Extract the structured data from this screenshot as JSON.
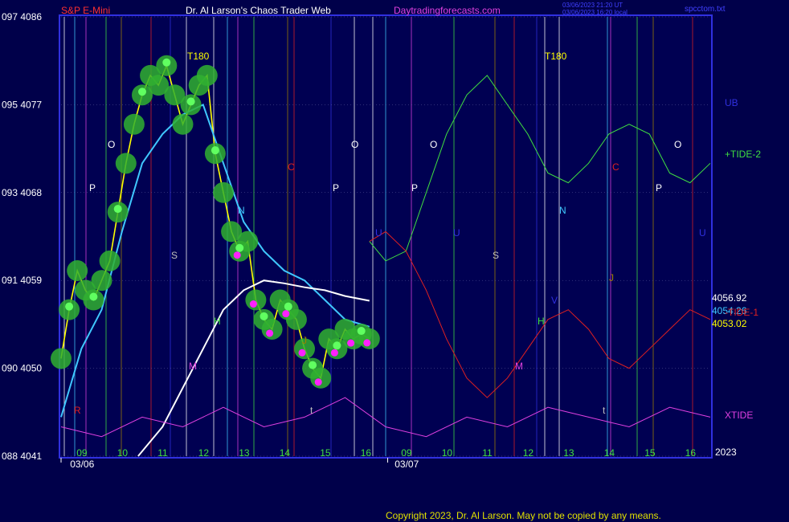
{
  "chart_data": {
    "type": "line",
    "title_left": "S&P E-Mini",
    "title_center": "Dr. Al Larson's Chaos Trader Web",
    "title_site": "Daytradingforecasts.com",
    "timestamp_1": "03/06/2023 21:20 UT",
    "timestamp_2": "03/06/2023 16:20 local",
    "file_label": "spcctom.txt",
    "copyright": "Copyright 2023, Dr. Al Larson. May not be copied by any means.",
    "year_label": "2023",
    "y_axis": {
      "range": [
        4041,
        4086
      ],
      "ticks": [
        {
          "label": "097 4086",
          "value": 4086
        },
        {
          "label": "095 4077",
          "value": 4077
        },
        {
          "label": "093 4068",
          "value": 4068
        },
        {
          "label": "091 4059",
          "value": 4059
        },
        {
          "label": "090 4050",
          "value": 4050
        },
        {
          "label": "088 4041",
          "value": 4041
        }
      ]
    },
    "x_axis": {
      "hour_labels": [
        "09",
        "10",
        "11",
        "12",
        "13",
        "14",
        "15",
        "16",
        "09",
        "10",
        "11",
        "12",
        "13",
        "14",
        "15",
        "16"
      ],
      "date_labels": [
        "03/06",
        "03/07"
      ]
    },
    "price_labels": [
      {
        "text": "4056.92",
        "color": "#ffffff"
      },
      {
        "text": "4054.26",
        "color": "#40c8ff"
      },
      {
        "text": "4053.02",
        "color": "#ffff00"
      }
    ],
    "legend": [
      {
        "text": "UB",
        "color": "#3030e0"
      },
      {
        "text": "+TIDE-2",
        "color": "#40e040"
      },
      {
        "text": "-TIDE-1",
        "color": "#e02020"
      },
      {
        "text": "XTIDE",
        "color": "#e040e0"
      }
    ],
    "markers": [
      {
        "text": "T180",
        "color": "#ffff00"
      },
      {
        "text": "T180",
        "color": "#ffff00"
      },
      {
        "text": "O",
        "color": "#ffffff"
      },
      {
        "text": "O",
        "color": "#ffffff"
      },
      {
        "text": "O",
        "color": "#ffffff"
      },
      {
        "text": "O",
        "color": "#ffffff"
      },
      {
        "text": "P",
        "color": "#ffffff"
      },
      {
        "text": "P",
        "color": "#ffffff"
      },
      {
        "text": "P",
        "color": "#ffffff"
      },
      {
        "text": "P",
        "color": "#ffffff"
      },
      {
        "text": "S",
        "color": "#c0c0c0"
      },
      {
        "text": "S",
        "color": "#c0c0c0"
      },
      {
        "text": "N",
        "color": "#40c8ff"
      },
      {
        "text": "N",
        "color": "#40c8ff"
      },
      {
        "text": "M",
        "color": "#e040e0"
      },
      {
        "text": "M",
        "color": "#e040e0"
      },
      {
        "text": "C",
        "color": "#e02020"
      },
      {
        "text": "C",
        "color": "#e02020"
      },
      {
        "text": "U",
        "color": "#3030e0"
      },
      {
        "text": "U",
        "color": "#3030e0"
      },
      {
        "text": "U",
        "color": "#3030e0"
      },
      {
        "text": "H",
        "color": "#40e040"
      },
      {
        "text": "H",
        "color": "#40e040"
      },
      {
        "text": "J",
        "color": "#a08000"
      },
      {
        "text": "J",
        "color": "#a08000"
      },
      {
        "text": "V",
        "color": "#3030e0"
      },
      {
        "text": "R",
        "color": "#e02020"
      },
      {
        "text": "t",
        "color": "#c0c0c0"
      },
      {
        "text": "t",
        "color": "#c0c0c0"
      },
      {
        "text": "t",
        "color": "#c0c0c0"
      }
    ],
    "series": [
      {
        "name": "price_yellow",
        "x": [
          0,
          0.2,
          0.4,
          0.6,
          0.8,
          1,
          1.2,
          1.4,
          1.6,
          1.8,
          2,
          2.2,
          2.4,
          2.6,
          2.8,
          3,
          3.2,
          3.4,
          3.6,
          3.8,
          4,
          4.2,
          4.4,
          4.6,
          4.8,
          5,
          5.2,
          5.4,
          5.6,
          5.8,
          6,
          6.2,
          6.4,
          6.6,
          6.8,
          7,
          7.2,
          7.4,
          7.6
        ],
        "y": [
          4051,
          4056,
          4060,
          4058,
          4057,
          4059,
          4061,
          4066,
          4071,
          4075,
          4078,
          4080,
          4079,
          4081,
          4078,
          4075,
          4077,
          4079,
          4080,
          4072,
          4068,
          4064,
          4062,
          4063,
          4057,
          4055,
          4054,
          4057,
          4056,
          4055,
          4052,
          4050,
          4049,
          4053,
          4052,
          4054,
          4053,
          4053.5,
          4053.02
        ]
      },
      {
        "name": "cyan",
        "x": [
          0,
          0.5,
          1,
          1.5,
          2,
          2.5,
          3,
          3.5,
          4,
          4.5,
          5,
          5.5,
          6,
          6.5,
          7,
          7.6
        ],
        "y": [
          4045,
          4052,
          4056,
          4064,
          4071,
          4074,
          4076,
          4077,
          4071,
          4065,
          4062,
          4060,
          4059,
          4057,
          4055,
          4054.26
        ]
      },
      {
        "name": "white",
        "x": [
          1.9,
          2.5,
          3,
          3.5,
          4,
          4.5,
          5,
          5.5,
          6,
          6.5,
          7,
          7.6
        ],
        "y": [
          4041,
          4044,
          4048,
          4052,
          4056,
          4058,
          4059,
          4058.7,
          4058.3,
          4058,
          4057.4,
          4056.92
        ]
      },
      {
        "name": "+TIDE-2",
        "x": [
          7.6,
          8,
          8.5,
          9,
          9.5,
          10,
          10.5,
          11,
          11.5,
          12,
          12.5,
          13,
          13.5,
          14,
          14.5,
          15,
          15.5,
          16
        ],
        "y": [
          4063,
          4061,
          4062,
          4068,
          4074,
          4078,
          4080,
          4077,
          4074,
          4070,
          4069,
          4071,
          4074,
          4075,
          4074,
          4070,
          4069,
          4071
        ]
      },
      {
        "name": "-TIDE-1",
        "x": [
          7.6,
          8,
          8.5,
          9,
          9.5,
          10,
          10.5,
          11,
          11.5,
          12,
          12.5,
          13,
          13.5,
          14,
          14.5,
          15,
          15.5,
          16
        ],
        "y": [
          4063,
          4064,
          4062,
          4058,
          4053,
          4049,
          4047,
          4049,
          4052,
          4055,
          4056,
          4054,
          4051,
          4050,
          4052,
          4054,
          4056,
          4055
        ]
      },
      {
        "name": "XTIDE",
        "x": [
          0,
          1,
          2,
          3,
          4,
          5,
          6,
          7,
          8,
          9,
          10,
          11,
          12,
          13,
          14,
          15,
          16
        ],
        "y": [
          4044,
          4043,
          4045,
          4044,
          4046,
          4044,
          4045,
          4047,
          4044,
          4043,
          4045,
          4044,
          4046,
          4045,
          4044,
          4046,
          4045
        ]
      }
    ]
  }
}
